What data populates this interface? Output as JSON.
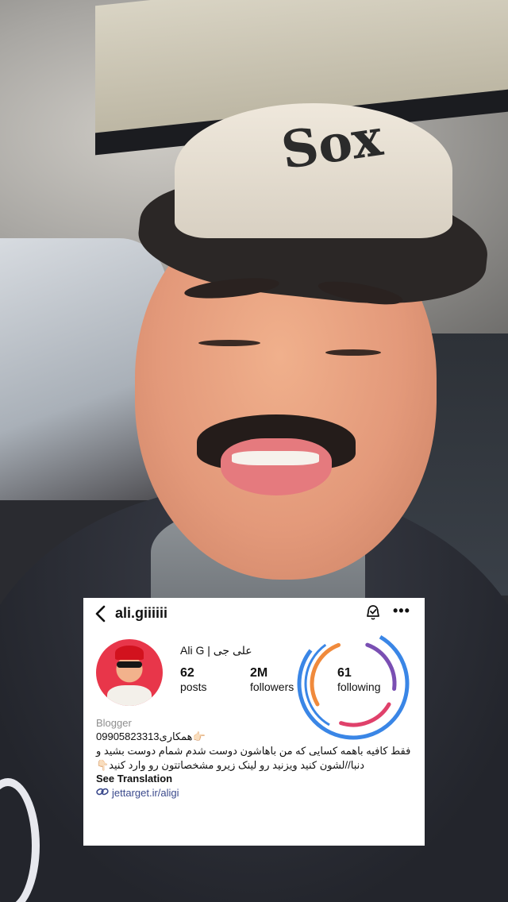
{
  "profile": {
    "username": "ali.giiiiii",
    "full_name": "Ali G | علی جی",
    "stats": [
      {
        "value": "62",
        "label": "posts"
      },
      {
        "value": "2M",
        "label": "followers"
      },
      {
        "value": "61",
        "label": "following"
      }
    ],
    "category": "Blogger",
    "bio_lines": [
      "👉🏻همکاری09905823313",
      "فقط کافیه باهمه کسایی که من باهاشون دوست شدم شمام دوست بشید و",
      "دنبا//لشون کنید ویزنید رو لینک زیرو مشخصاتتون رو وارد کنید👇🏻"
    ],
    "see_translation": "See Translation",
    "link": "jettarget.ir/aligi"
  },
  "icons": {
    "back": "chevron-left-icon",
    "notifications": "bell-icon",
    "more": "more-horizontal-icon",
    "link": "link-icon"
  },
  "colors": {
    "ring_blue": "#3a86e6",
    "ring_orange": "#f08a3c",
    "ring_purple": "#7a4fb3",
    "ring_pink": "#e0416b",
    "link_color": "#3b4a8c"
  }
}
